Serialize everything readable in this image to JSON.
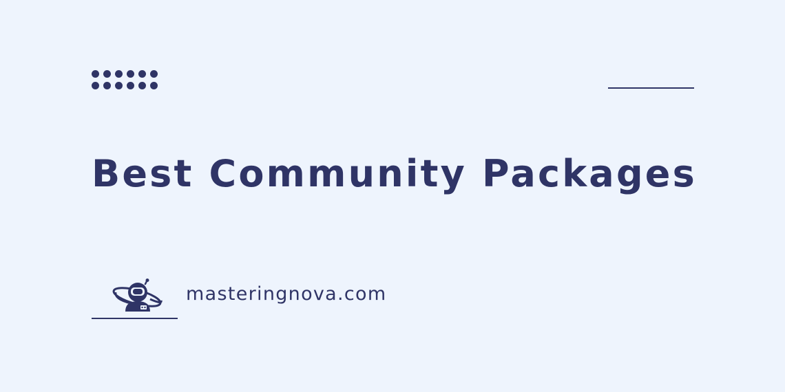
{
  "colors": {
    "ink": "#2f3466",
    "background": "#eef4fd"
  },
  "title": "Best Community Packages",
  "logo": {
    "icon": "astronaut-planet-icon"
  },
  "site": "masteringnova.com"
}
